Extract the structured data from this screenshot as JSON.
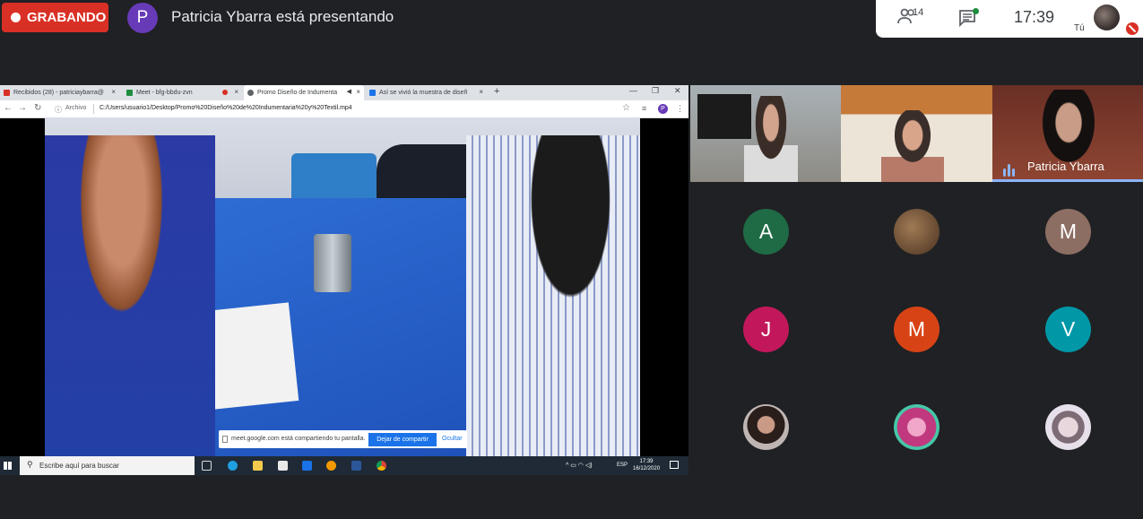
{
  "recording": {
    "label": "GRABANDO"
  },
  "presenter": {
    "initial": "P",
    "status": "Patricia Ybarra está presentando"
  },
  "top_right": {
    "people_count": "14",
    "time": "17:39",
    "self_label": "Tú"
  },
  "browser": {
    "tabs": [
      {
        "label": "Recibidos (28) - patriciaybarra@",
        "favicon_color": "#d93025"
      },
      {
        "label": "Meet - bfg-bbdu-zvn",
        "favicon_color": "#1e8e3e"
      },
      {
        "label": "Promo Diseño de Indumenta",
        "favicon_color": "#5f6368"
      },
      {
        "label": "Así se vivió la muestra de diseñ",
        "favicon_color": "#1a73e8"
      }
    ],
    "new_tab": "+",
    "archivo_label": "Archivo",
    "url": "C:/Users/usuario1/Desktop/Promo%20Diseño%20de%20Indumentaria%20y%20Textil.mp4",
    "profile_initial": "P"
  },
  "share_notice": {
    "message": "meet.google.com está compartiendo tu pantalla.",
    "stop_label": "Dejar de compartir",
    "hide_label": "Ocultar"
  },
  "taskbar": {
    "search_placeholder": "Escribe aquí para buscar",
    "lang": "ESP",
    "clock_time": "17:39",
    "clock_date": "16/12/2020"
  },
  "video_tiles": [
    {
      "name": ""
    },
    {
      "name": ""
    },
    {
      "name": "Patricia Ybarra"
    }
  ],
  "participants": [
    {
      "initial": "A",
      "color": "#1e6b45"
    },
    {
      "initial": "",
      "color": "#6b4a2e"
    },
    {
      "initial": "M",
      "color": "#8d6e63"
    },
    {
      "initial": "J",
      "color": "#c2185b"
    },
    {
      "initial": "M",
      "color": "#d84315"
    },
    {
      "initial": "V",
      "color": "#0097a7"
    },
    {
      "initial": "",
      "color": "#b38b7a"
    },
    {
      "initial": "",
      "color": "#d06aa0"
    },
    {
      "initial": "",
      "color": "#d8d2d8"
    }
  ]
}
